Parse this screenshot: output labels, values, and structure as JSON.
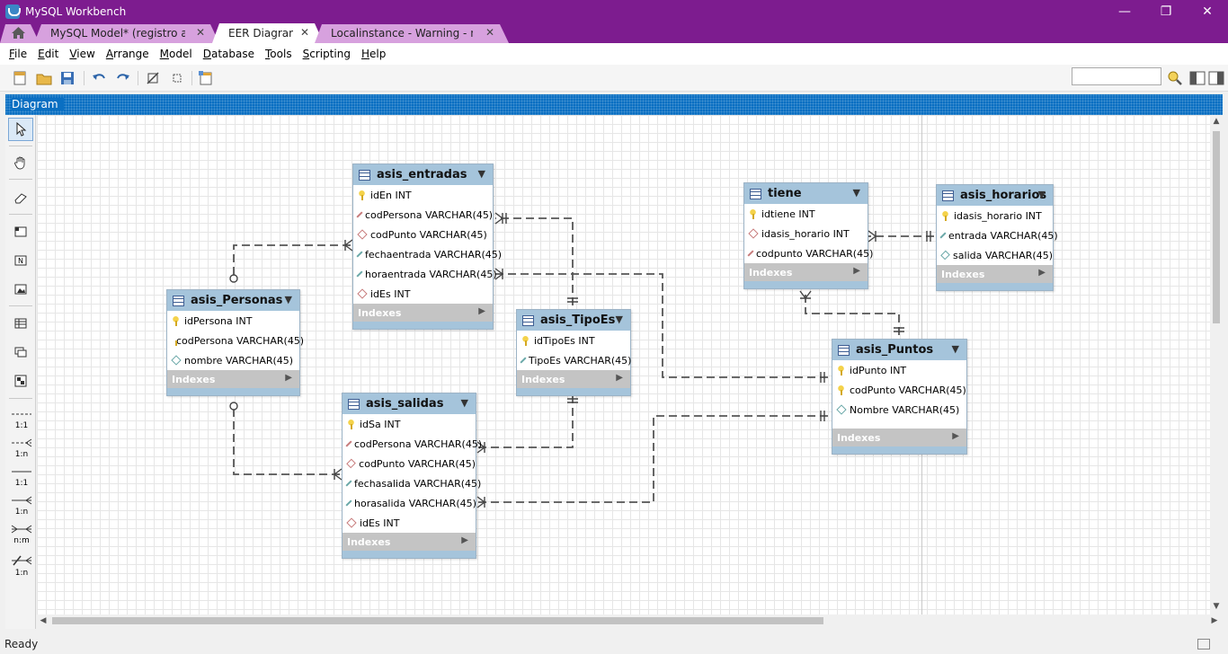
{
  "window": {
    "title": "MySQL Workbench"
  },
  "tabs": [
    {
      "label": "MySQL Model* (registro asistencia",
      "active": false
    },
    {
      "label": "EER Diagram",
      "active": true
    },
    {
      "label": "Localinstance - Warning - not sup...",
      "active": false
    }
  ],
  "menu": [
    {
      "first": "F",
      "rest": "ile"
    },
    {
      "first": "E",
      "rest": "dit"
    },
    {
      "first": "V",
      "rest": "iew"
    },
    {
      "first": "A",
      "rest": "rrange"
    },
    {
      "first": "M",
      "rest": "odel"
    },
    {
      "first": "D",
      "rest": "atabase"
    },
    {
      "first": "T",
      "rest": "ools"
    },
    {
      "first": "S",
      "rest": "cripting"
    },
    {
      "first": "H",
      "rest": "elp"
    }
  ],
  "panel": {
    "title": "Diagram"
  },
  "palette": {
    "rel_11_nonid": "1:1",
    "rel_1n_nonid": "1:n",
    "rel_11_id": "1:1",
    "rel_1n_id": "1:n",
    "rel_nm": "n:m",
    "rel_1n_existing": "1:n"
  },
  "tables": {
    "asis_entradas": {
      "name": "asis_entradas",
      "columns": [
        {
          "text": "idEn INT",
          "kind": "pk"
        },
        {
          "text": "codPersona VARCHAR(45)",
          "kind": "fk"
        },
        {
          "text": "codPunto VARCHAR(45)",
          "kind": "fk"
        },
        {
          "text": "fechaentrada VARCHAR(45)",
          "kind": "col"
        },
        {
          "text": "horaentrada VARCHAR(45)",
          "kind": "col"
        },
        {
          "text": "idEs INT",
          "kind": "fk"
        }
      ],
      "indexes": "Indexes"
    },
    "asis_personas": {
      "name": "asis_Personas",
      "columns": [
        {
          "text": "idPersona INT",
          "kind": "pk"
        },
        {
          "text": "codPersona VARCHAR(45)",
          "kind": "pk"
        },
        {
          "text": "nombre VARCHAR(45)",
          "kind": "col"
        }
      ],
      "indexes": "Indexes"
    },
    "asis_salidas": {
      "name": "asis_salidas",
      "columns": [
        {
          "text": "idSa INT",
          "kind": "pk"
        },
        {
          "text": "codPersona VARCHAR(45)",
          "kind": "fk"
        },
        {
          "text": "codPunto VARCHAR(45)",
          "kind": "fk"
        },
        {
          "text": "fechasalida VARCHAR(45)",
          "kind": "col"
        },
        {
          "text": "horasalida VARCHAR(45)",
          "kind": "col"
        },
        {
          "text": "idEs INT",
          "kind": "fk"
        }
      ],
      "indexes": "Indexes"
    },
    "asis_tipoes": {
      "name": "asis_TipoEs",
      "columns": [
        {
          "text": "idTipoEs INT",
          "kind": "pk"
        },
        {
          "text": "TipoEs VARCHAR(45)",
          "kind": "col"
        }
      ],
      "indexes": "Indexes"
    },
    "tiene": {
      "name": "tiene",
      "columns": [
        {
          "text": "idtiene INT",
          "kind": "pk"
        },
        {
          "text": "idasis_horario INT",
          "kind": "fk"
        },
        {
          "text": "codpunto VARCHAR(45)",
          "kind": "fk"
        }
      ],
      "indexes": "Indexes"
    },
    "asis_horarios": {
      "name": "asis_horarios",
      "columns": [
        {
          "text": "idasis_horario INT",
          "kind": "pk"
        },
        {
          "text": "entrada VARCHAR(45)",
          "kind": "col"
        },
        {
          "text": "salida VARCHAR(45)",
          "kind": "col"
        }
      ],
      "indexes": "Indexes"
    },
    "asis_puntos": {
      "name": "asis_Puntos",
      "columns": [
        {
          "text": "idPunto INT",
          "kind": "pk"
        },
        {
          "text": "codPunto VARCHAR(45)",
          "kind": "pk"
        },
        {
          "text": "Nombre VARCHAR(45)",
          "kind": "col"
        }
      ],
      "indexes": "Indexes"
    }
  },
  "status": {
    "text": "Ready"
  },
  "colors": {
    "title_bar": "#7d1c8f",
    "panel_header": "#0a6fc2",
    "table_header": "#a5c4db",
    "indexes_bar": "#c4c4c4"
  }
}
